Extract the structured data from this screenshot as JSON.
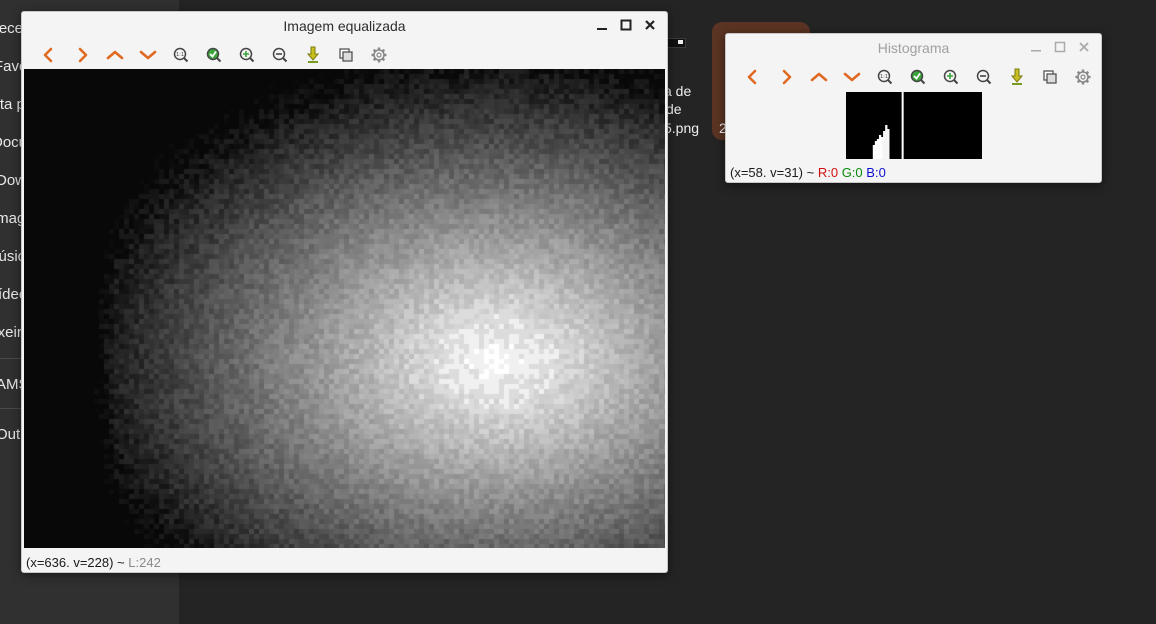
{
  "file_manager": {
    "sidebar_items": [
      "Recentes",
      "Favoritos",
      "Pasta pessoal",
      "Documentos",
      "Downloads",
      "Imagens",
      "Músicas",
      "Vídeos",
      "Lixeira",
      "AMS",
      "Outros locais"
    ],
    "file_label_lines": [
      "a de",
      "de",
      "5.png"
    ],
    "selected_file_label": "2"
  },
  "main_window": {
    "title": "Imagem equalizada",
    "toolbar": [
      {
        "name": "back-icon",
        "glyph": "‹"
      },
      {
        "name": "forward-icon",
        "glyph": "›"
      },
      {
        "name": "up-icon",
        "glyph": "^"
      },
      {
        "name": "down-icon",
        "glyph": "v"
      },
      {
        "name": "zoom-fit-icon",
        "glyph": "1:1"
      },
      {
        "name": "zoom-ok-icon",
        "glyph": "✓"
      },
      {
        "name": "zoom-in-icon",
        "glyph": "+"
      },
      {
        "name": "zoom-out-icon",
        "glyph": "−"
      },
      {
        "name": "save-icon",
        "glyph": "↓"
      },
      {
        "name": "copy-icon",
        "glyph": "⧉"
      },
      {
        "name": "settings-icon",
        "glyph": "⚙"
      }
    ],
    "status": {
      "coords": "(x=636. v=228) ~",
      "value": "L:242"
    }
  },
  "histogram_window": {
    "title": "Histograma",
    "status": {
      "coords": "(x=58. v=31) ~",
      "r": "R:0",
      "g": "G:0",
      "b": "B:0"
    },
    "histogram_counts": [
      0,
      0,
      0,
      0,
      0,
      0,
      0,
      0,
      0,
      0,
      0,
      0,
      0,
      0,
      0,
      0,
      0,
      0,
      0,
      0,
      0,
      0,
      0,
      0,
      0,
      0,
      14,
      14,
      18,
      18,
      20,
      20,
      24,
      24,
      22,
      22,
      28,
      28,
      34,
      34,
      30,
      30,
      0,
      0,
      0,
      0,
      0,
      0,
      0,
      0,
      0,
      0,
      0,
      0,
      0,
      0,
      0,
      0,
      0,
      0,
      0,
      0,
      0,
      0,
      0,
      0,
      0,
      0,
      0,
      0,
      0,
      0,
      0,
      0,
      0,
      0,
      0,
      0,
      0,
      0,
      0,
      0,
      0,
      0,
      0,
      0,
      0,
      0,
      0,
      0,
      0,
      0,
      0,
      0,
      0,
      0,
      0,
      0,
      0,
      0,
      0,
      0,
      0,
      0,
      0,
      0,
      0,
      0,
      0,
      0,
      0,
      0,
      0,
      0,
      0,
      0,
      0,
      0,
      0,
      0,
      0,
      0,
      0,
      0,
      0,
      0,
      0,
      0,
      0,
      0,
      0,
      0
    ],
    "selected_bin": 54
  },
  "colors": {
    "desktop_bg": "#242424",
    "sidebar_bg": "#303030",
    "arrow_orange": "#e06a22",
    "zoom_green": "#3aa53a",
    "save_yellow": "#c8c020"
  }
}
